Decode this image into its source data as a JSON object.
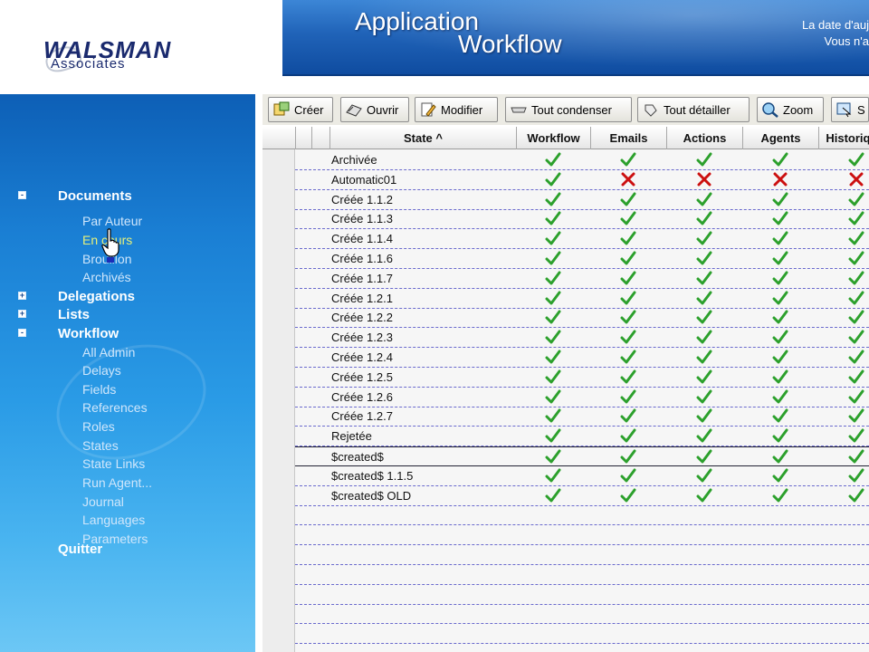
{
  "logo": {
    "main": "WALSMAN",
    "sub": "Associates"
  },
  "header": {
    "title_line1": "Application",
    "title_line2": "Workflow",
    "date_text": "La date d'auj",
    "user_text": "Vous n'a"
  },
  "sidebar": {
    "groups": [
      {
        "label": "Documents",
        "toggle": "-",
        "items": [
          {
            "label": "Par Auteur",
            "active": false
          },
          {
            "label": "En cours",
            "active": true
          },
          {
            "label": "Brouillon",
            "active": false
          },
          {
            "label": "Archivés",
            "active": false
          }
        ]
      },
      {
        "label": "Delegations",
        "toggle": "+",
        "items": []
      },
      {
        "label": "Lists",
        "toggle": "+",
        "items": []
      },
      {
        "label": "Workflow",
        "toggle": "-",
        "items": [
          {
            "label": "All Admin",
            "active": false
          },
          {
            "label": "Delays",
            "active": false
          },
          {
            "label": "Fields",
            "active": false
          },
          {
            "label": "References",
            "active": false
          },
          {
            "label": "Roles",
            "active": false
          },
          {
            "label": "States",
            "active": false
          },
          {
            "label": "State Links",
            "active": false
          },
          {
            "label": "Run Agent...",
            "active": false
          },
          {
            "label": "Journal",
            "active": false
          },
          {
            "label": "Languages",
            "active": false
          },
          {
            "label": "Parameters",
            "active": false
          }
        ]
      }
    ],
    "quit_label": "Quitter"
  },
  "toolbar": {
    "buttons": [
      {
        "label": "Créer",
        "icon": "create-icon"
      },
      {
        "label": "Ouvrir",
        "icon": "open-icon"
      },
      {
        "label": "Modifier",
        "icon": "edit-icon"
      },
      {
        "label": "Tout condenser",
        "icon": "collapse-icon"
      },
      {
        "label": "Tout détailler",
        "icon": "expand-icon"
      },
      {
        "label": "Zoom",
        "icon": "zoom-icon"
      },
      {
        "label": "S",
        "icon": "select-icon"
      }
    ]
  },
  "grid": {
    "columns": [
      "State ^",
      "Workflow",
      "Emails",
      "Actions",
      "Agents",
      "Historique"
    ],
    "rows": [
      {
        "state": "Archivée",
        "marks": [
          "check",
          "check",
          "check",
          "check",
          "check"
        ]
      },
      {
        "state": "Automatic01",
        "marks": [
          "check",
          "cross",
          "cross",
          "cross",
          "cross"
        ]
      },
      {
        "state": "Créée 1.1.2",
        "marks": [
          "check",
          "check",
          "check",
          "check",
          "check"
        ]
      },
      {
        "state": "Créée 1.1.3",
        "marks": [
          "check",
          "check",
          "check",
          "check",
          "check"
        ]
      },
      {
        "state": "Créée 1.1.4",
        "marks": [
          "check",
          "check",
          "check",
          "check",
          "check"
        ]
      },
      {
        "state": "Créée 1.1.6",
        "marks": [
          "check",
          "check",
          "check",
          "check",
          "check"
        ]
      },
      {
        "state": "Créée 1.1.7",
        "marks": [
          "check",
          "check",
          "check",
          "check",
          "check"
        ]
      },
      {
        "state": "Créée 1.2.1",
        "marks": [
          "check",
          "check",
          "check",
          "check",
          "check"
        ]
      },
      {
        "state": "Créée 1.2.2",
        "marks": [
          "check",
          "check",
          "check",
          "check",
          "check"
        ]
      },
      {
        "state": "Créée 1.2.3",
        "marks": [
          "check",
          "check",
          "check",
          "check",
          "check"
        ]
      },
      {
        "state": "Créée 1.2.4",
        "marks": [
          "check",
          "check",
          "check",
          "check",
          "check"
        ]
      },
      {
        "state": "Créée 1.2.5",
        "marks": [
          "check",
          "check",
          "check",
          "check",
          "check"
        ]
      },
      {
        "state": "Créée 1.2.6",
        "marks": [
          "check",
          "check",
          "check",
          "check",
          "check"
        ]
      },
      {
        "state": "Créée 1.2.7",
        "marks": [
          "check",
          "check",
          "check",
          "check",
          "check"
        ]
      },
      {
        "state": "Rejetée",
        "marks": [
          "check",
          "check",
          "check",
          "check",
          "check"
        ]
      },
      {
        "state": "$created$",
        "marks": [
          "check",
          "check",
          "check",
          "check",
          "check"
        ],
        "current": true
      },
      {
        "state": "$created$ 1.1.5",
        "marks": [
          "check",
          "check",
          "check",
          "check",
          "check"
        ]
      },
      {
        "state": "$created$ OLD",
        "marks": [
          "check",
          "check",
          "check",
          "check",
          "check"
        ]
      }
    ]
  },
  "colors": {
    "check": "#2ca02c",
    "cross": "#cc1010",
    "row_separator": "#6a6acd"
  }
}
